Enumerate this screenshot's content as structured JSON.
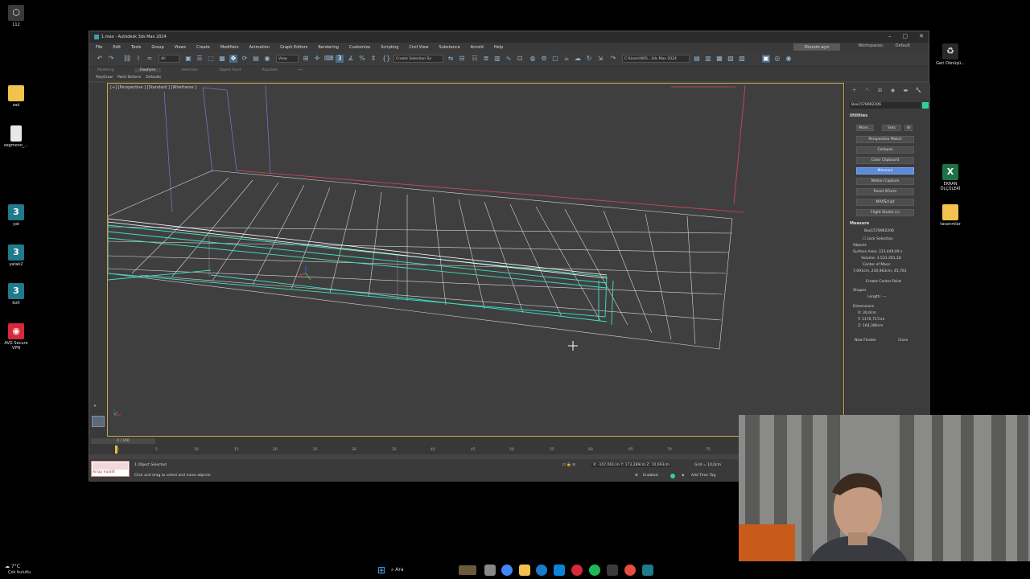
{
  "desktop": {
    "icons": [
      {
        "label": "112",
        "glyph": "⬡",
        "color": "#3a3a3a"
      },
      {
        "label": "sad",
        "glyph": "",
        "color": "#f2c14e"
      },
      {
        "label": "segmono_...",
        "glyph": "",
        "color": "#e8e8e8"
      },
      {
        "label": "yat",
        "glyph": "3",
        "color": "#1f7a8c"
      },
      {
        "label": "yatak2",
        "glyph": "3",
        "color": "#1f7a8c"
      },
      {
        "label": "kolt",
        "glyph": "3",
        "color": "#1f7a8c"
      },
      {
        "label": "AVG Secure VPN",
        "glyph": "◉",
        "color": "#d6283a"
      }
    ],
    "right_icons": [
      {
        "label": "Geri Dönüşü...",
        "glyph": "🗑",
        "color": "#3a3a3a"
      },
      {
        "label": "EKRAN ÖLÇÜLERİ",
        "glyph": "X",
        "color": "#1e7145"
      },
      {
        "label": "tasarımlar",
        "glyph": "",
        "color": "#f2c14e"
      }
    ]
  },
  "window": {
    "title": "1.max - Autodesk 3ds Max 2024",
    "signin": "Oturum açın",
    "workspaces_label": "Workspaces:",
    "workspaces_value": "Default",
    "controls": [
      "–",
      "▢",
      "✕"
    ]
  },
  "menu": [
    "File",
    "Edit",
    "Tools",
    "Group",
    "Views",
    "Create",
    "Modifiers",
    "Animation",
    "Graph Editors",
    "Rendering",
    "Customize",
    "Scripting",
    "Civil View",
    "Substance",
    "Arnold",
    "Help"
  ],
  "toolbar": {
    "selection_filter": "All",
    "view_dropdown": "View",
    "create_selection_set": "Create Selection Se",
    "path_box": "C:\\Users\\905...3ds Max 2024"
  },
  "ribbon": {
    "tabs": [
      "Modeling",
      "Freeform",
      "Selection",
      "Object Paint",
      "Populate"
    ],
    "active_tab": "Freeform",
    "subtabs": [
      "PolyDraw",
      "Paint Deform",
      "Defaults"
    ]
  },
  "viewport": {
    "label": "[+] [Perspective ] [Standard ] [Wireframe ]"
  },
  "command_panel": {
    "object_name": "Box1578962206",
    "object_color": "#2fd0a0",
    "utilities_title": "Utilities",
    "small_buttons": [
      "More...",
      "Sets",
      "⚙"
    ],
    "utility_buttons": [
      "Perspective Match",
      "Collapse",
      "Color Clipboard",
      "Measure",
      "Motion Capture",
      "Reset XForm",
      "MAXScript",
      "Flight Studio (c)"
    ],
    "active_utility": "Measure",
    "measure": {
      "title": "Measure",
      "object": "Box1578962206",
      "lock_selection": "Lock Selection",
      "objects_label": "Objects",
      "surface_area": "Surface Area: 313.449,09 s",
      "volume": "Volume: 3.531.261,18",
      "center_of_mass_label": "Center of Mass:",
      "center_of_mass": "7,091cm, 230,963cm, 45,761",
      "create_center_point": "Create Center Point",
      "shapes_label": "Shapes",
      "length": "Length: ---",
      "dimensions_label": "Dimensions",
      "dim_x": "X: 30,0cm",
      "dim_y": "Y: 1170,717cm",
      "dim_z": "Z: 164,386cm",
      "new_floater": "New Floater",
      "close": "Close"
    }
  },
  "timeline": {
    "slider": "0 / 100",
    "ticks": [
      "0",
      "5",
      "10",
      "15",
      "20",
      "25",
      "30",
      "35",
      "40",
      "45",
      "50",
      "55",
      "60",
      "65",
      "70",
      "75"
    ]
  },
  "status": {
    "selected": "1 Object Selected",
    "hint": "Click and drag to select and move objects",
    "maxscript_text": "Array modifi",
    "coords": "X: -107,061cm  Y: 173,289cm  Z: 10,693cm",
    "grid": "Grid = 10,0cm",
    "enabled": "Enabled:",
    "add_time_tag": "Add Time Tag"
  },
  "taskbar": {
    "weather": "7°C",
    "weather_desc": "Çok bulutlu",
    "search_placeholder": "Ara"
  }
}
